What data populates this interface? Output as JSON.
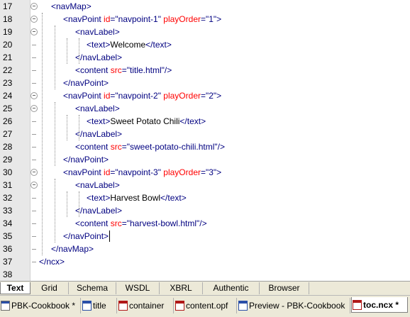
{
  "editor": {
    "lines": [
      {
        "num": "17",
        "fold": true,
        "parts": [
          {
            "c": "t",
            "s": "<navMap>"
          }
        ]
      },
      {
        "num": "18",
        "fold": true,
        "parts": [
          {
            "c": "t",
            "s": "<navPoint "
          },
          {
            "c": "a",
            "s": "id"
          },
          {
            "c": "v",
            "s": "=\"navpoint-1\" "
          },
          {
            "c": "a",
            "s": "playOrder"
          },
          {
            "c": "v",
            "s": "=\"1\">"
          }
        ]
      },
      {
        "num": "19",
        "fold": true,
        "parts": [
          {
            "c": "t",
            "s": "<navLabel>"
          }
        ]
      },
      {
        "num": "20",
        "fold": false,
        "parts": [
          {
            "c": "t",
            "s": "<text>"
          },
          {
            "c": "x",
            "s": "Welcome"
          },
          {
            "c": "t",
            "s": "</text>"
          }
        ]
      },
      {
        "num": "21",
        "fold": false,
        "parts": [
          {
            "c": "t",
            "s": "</navLabel>"
          }
        ]
      },
      {
        "num": "22",
        "fold": false,
        "parts": [
          {
            "c": "t",
            "s": "<content "
          },
          {
            "c": "a",
            "s": "src"
          },
          {
            "c": "v",
            "s": "=\"title.html\"/>"
          }
        ]
      },
      {
        "num": "23",
        "fold": false,
        "parts": [
          {
            "c": "t",
            "s": "</navPoint>"
          }
        ]
      },
      {
        "num": "24",
        "fold": true,
        "parts": [
          {
            "c": "t",
            "s": "<navPoint "
          },
          {
            "c": "a",
            "s": "id"
          },
          {
            "c": "v",
            "s": "=\"navpoint-2\" "
          },
          {
            "c": "a",
            "s": "playOrder"
          },
          {
            "c": "v",
            "s": "=\"2\">"
          }
        ]
      },
      {
        "num": "25",
        "fold": true,
        "parts": [
          {
            "c": "t",
            "s": "<navLabel>"
          }
        ]
      },
      {
        "num": "26",
        "fold": false,
        "parts": [
          {
            "c": "t",
            "s": "<text>"
          },
          {
            "c": "x",
            "s": "Sweet Potato Chili"
          },
          {
            "c": "t",
            "s": "</text>"
          }
        ]
      },
      {
        "num": "27",
        "fold": false,
        "parts": [
          {
            "c": "t",
            "s": "</navLabel>"
          }
        ]
      },
      {
        "num": "28",
        "fold": false,
        "parts": [
          {
            "c": "t",
            "s": "<content "
          },
          {
            "c": "a",
            "s": "src"
          },
          {
            "c": "v",
            "s": "=\"sweet-potato-chili.html\"/>"
          }
        ]
      },
      {
        "num": "29",
        "fold": false,
        "parts": [
          {
            "c": "t",
            "s": "</navPoint>"
          }
        ]
      },
      {
        "num": "30",
        "fold": true,
        "parts": [
          {
            "c": "t",
            "s": "<navPoint "
          },
          {
            "c": "a",
            "s": "id"
          },
          {
            "c": "v",
            "s": "=\"navpoint-3\" "
          },
          {
            "c": "a",
            "s": "playOrder"
          },
          {
            "c": "v",
            "s": "=\"3\">"
          }
        ]
      },
      {
        "num": "31",
        "fold": true,
        "parts": [
          {
            "c": "t",
            "s": "<navLabel>"
          }
        ]
      },
      {
        "num": "32",
        "fold": false,
        "parts": [
          {
            "c": "t",
            "s": "<text>"
          },
          {
            "c": "x",
            "s": "Harvest Bowl"
          },
          {
            "c": "t",
            "s": "</text>"
          }
        ]
      },
      {
        "num": "33",
        "fold": false,
        "parts": [
          {
            "c": "t",
            "s": "</navLabel>"
          }
        ]
      },
      {
        "num": "34",
        "fold": false,
        "parts": [
          {
            "c": "t",
            "s": "<content "
          },
          {
            "c": "a",
            "s": "src"
          },
          {
            "c": "v",
            "s": "=\"harvest-bowl.html\"/>"
          }
        ]
      },
      {
        "num": "35",
        "fold": false,
        "cursor": true,
        "parts": [
          {
            "c": "t",
            "s": "</navPoint>"
          }
        ]
      },
      {
        "num": "36",
        "fold": false,
        "parts": [
          {
            "c": "t",
            "s": "</navMap>"
          }
        ]
      },
      {
        "num": "37",
        "fold": false,
        "parts": [
          {
            "c": "t",
            "s": "</ncx>"
          }
        ]
      },
      {
        "num": "38",
        "fold": false,
        "parts": []
      }
    ]
  },
  "view_tabs": [
    {
      "label": "Text",
      "active": true
    },
    {
      "label": "Grid",
      "active": false
    },
    {
      "label": "Schema",
      "active": false
    },
    {
      "label": "WSDL",
      "active": false
    },
    {
      "label": "XBRL",
      "active": false
    },
    {
      "label": "Authentic",
      "active": false
    },
    {
      "label": "Browser",
      "active": false
    }
  ],
  "doc_tabs": [
    {
      "label": "PBK-Cookbook *",
      "icon": "project-file-icon",
      "active": false
    },
    {
      "label": "title",
      "icon": "html-file-icon",
      "active": false
    },
    {
      "label": "container",
      "icon": "xml-file-icon",
      "active": false
    },
    {
      "label": "content.opf",
      "icon": "xml-file-icon",
      "active": false
    },
    {
      "label": "Preview - PBK-Cookbook",
      "icon": "html-file-icon",
      "active": false
    },
    {
      "label": "toc.ncx *",
      "icon": "xml-file-icon",
      "active": true
    }
  ],
  "colors": {
    "tag": "#000080",
    "attribute": "#ff0000",
    "text": "#000000",
    "gutter": "#e8e8e8"
  }
}
